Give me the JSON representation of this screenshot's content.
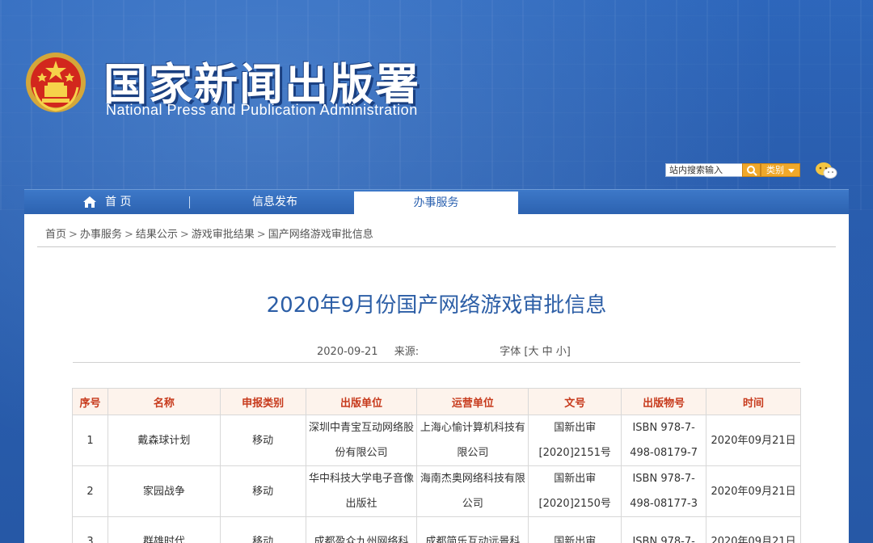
{
  "header": {
    "title": "国家新闻出版署",
    "subtitle": "National  Press and Publication Administration",
    "search_placeholder": "站内搜索输入",
    "category_label": "类别"
  },
  "nav": {
    "home": "首 页",
    "info": "信息发布",
    "service": "办事服务"
  },
  "breadcrumb": [
    "首页",
    "办事服务",
    "结果公示",
    "游戏审批结果",
    "国产网络游戏审批信息"
  ],
  "breadcrumb_sep": ">",
  "article": {
    "title": "2020年9月份国产网络游戏审批信息",
    "date": "2020-09-21",
    "source_label": "来源:",
    "font_label": "字体 [大 中 小]"
  },
  "table": {
    "headers": [
      "序号",
      "名称",
      "申报类别",
      "出版单位",
      "运营单位",
      "文号",
      "出版物号",
      "时间"
    ],
    "rows": [
      [
        "1",
        "戴森球计划",
        "移动",
        "深圳中青宝互动网络股份有限公司",
        "上海心愉计算机科技有限公司",
        "国新出审[2020]2151号",
        "ISBN 978-7-498-08179-7",
        "2020年09月21日"
      ],
      [
        "2",
        "家园战争",
        "移动",
        "华中科技大学电子音像出版社",
        "海南杰奥网络科技有限公司",
        "国新出审[2020]2150号",
        "ISBN 978-7-498-08177-3",
        "2020年09月21日"
      ],
      [
        "3",
        "群雄时代",
        "移动",
        "成都盈众九州网络科",
        "成都简乐互动远景科",
        "国新出审",
        "ISBN 978-7-",
        "2020年09月21日"
      ]
    ]
  },
  "colors": {
    "brand_blue": "#2a5fb0",
    "title_blue": "#2c5ea6",
    "header_red": "#c73a1c",
    "accent_orange": "#f0a82a"
  },
  "icons": {
    "emblem": "national-emblem-icon",
    "search": "search-icon",
    "wechat": "wechat-icon",
    "home": "home-icon"
  }
}
